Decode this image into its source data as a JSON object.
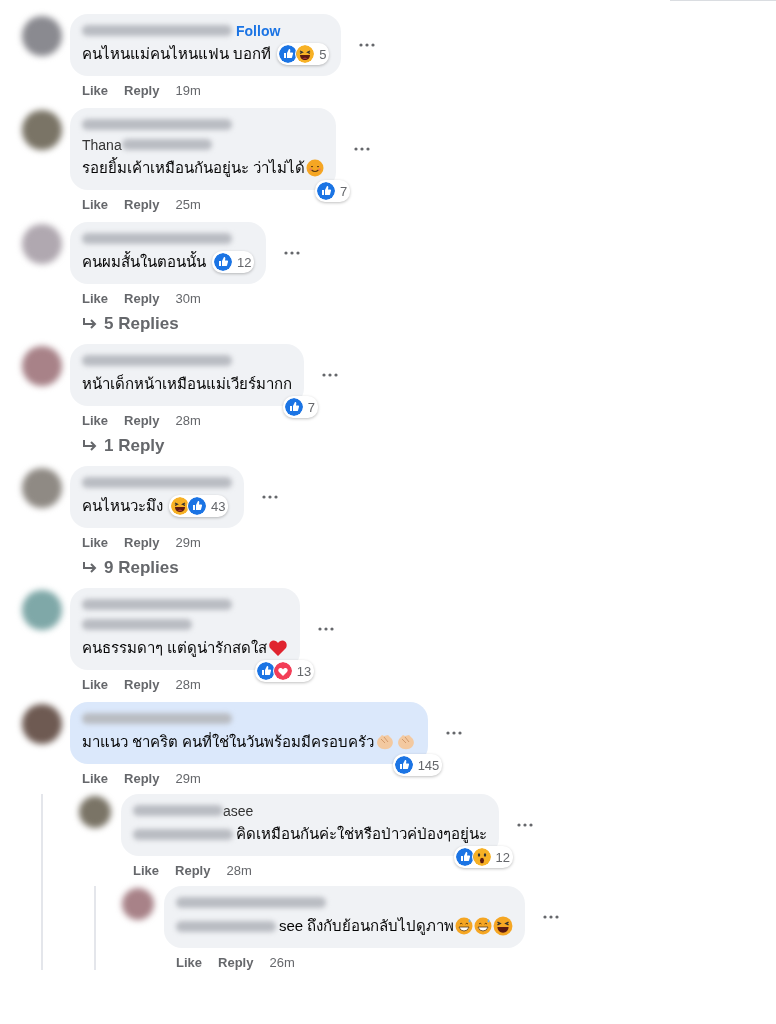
{
  "comments": [
    {
      "header": [
        {
          "kind": "blurred",
          "follow": "Follow"
        }
      ],
      "text": "คนไหนแม่คนไหนแฟน บอกที",
      "reactions": [
        {
          "kind": "like"
        },
        {
          "kind": "haha"
        }
      ],
      "reaction_count": "5",
      "inline": true,
      "like": "Like",
      "reply": "Reply",
      "time": "19m"
    },
    {
      "header": [
        {
          "kind": "blurred"
        },
        {
          "kind": "partial",
          "text": "Thana"
        }
      ],
      "text": "รอยยิ้มเค้าเหมือนกันอยู่นะ ว่าไม่ได้",
      "emojis": [
        {
          "kind": "smile"
        }
      ],
      "reactions": [
        {
          "kind": "like"
        }
      ],
      "reaction_count": "7",
      "inline": false,
      "like": "Like",
      "reply": "Reply",
      "time": "25m"
    },
    {
      "header": [
        {
          "kind": "blurred"
        }
      ],
      "text": "คนผมสั้นในตอนนั้น",
      "reactions": [
        {
          "kind": "like"
        }
      ],
      "reaction_count": "12",
      "inline": true,
      "like": "Like",
      "reply": "Reply",
      "time": "30m",
      "replies_link": "5 Replies"
    },
    {
      "header": [
        {
          "kind": "blurred"
        }
      ],
      "text": "หน้าเด็กหน้าเหมือนแม่เวียร์มากก",
      "reactions": [
        {
          "kind": "like"
        }
      ],
      "reaction_count": "7",
      "inline": false,
      "like": "Like",
      "reply": "Reply",
      "time": "28m",
      "replies_link": "1 Reply"
    },
    {
      "header": [
        {
          "kind": "blurred"
        }
      ],
      "text": "คนไหนวะมึง",
      "reactions": [
        {
          "kind": "haha"
        },
        {
          "kind": "like"
        }
      ],
      "reaction_count": "43",
      "inline": true,
      "like": "Like",
      "reply": "Reply",
      "time": "29m",
      "replies_link": "9 Replies"
    },
    {
      "header": [
        {
          "kind": "blurred"
        },
        {
          "kind": "blurred"
        }
      ],
      "text": "คนธรรมดาๆ แต่ดูน่ารักสดใส",
      "emojis": [
        {
          "kind": "heart"
        }
      ],
      "reactions": [
        {
          "kind": "like"
        },
        {
          "kind": "love"
        }
      ],
      "reaction_count": "13",
      "inline": false,
      "like": "Like",
      "reply": "Reply",
      "time": "28m"
    },
    {
      "header": [
        {
          "kind": "blurred"
        }
      ],
      "text": "มาแนว ชาคริต คนที่ใช่ในวันพร้อมมีครอบครัว",
      "emojis": [
        {
          "kind": "clap"
        },
        {
          "kind": "clap"
        }
      ],
      "reactions": [
        {
          "kind": "like"
        }
      ],
      "reaction_count": "145",
      "inline": false,
      "like": "Like",
      "reply": "Reply",
      "time": "29m",
      "highlighted": true,
      "replies": [
        {
          "header": [
            {
              "kind": "partial-end",
              "text": "asee"
            }
          ],
          "text_blurred_lead": true,
          "text": "คิดเหมือนกันค่ะใช่หรือป่าวค่ป่องๆอยู่นะ",
          "reactions": [
            {
              "kind": "like"
            },
            {
              "kind": "wow"
            }
          ],
          "reaction_count": "12",
          "inline": false,
          "like": "Like",
          "reply": "Reply",
          "time": "28m",
          "replies": [
            {
              "header": [
                {
                  "kind": "blurred"
                }
              ],
              "text_blurred_lead": true,
              "text": "see ถึงกับย้อนกลับไปดูภาพ",
              "emojis": [
                {
                  "kind": "sweat"
                },
                {
                  "kind": "sweat"
                },
                {
                  "kind": "laugh"
                }
              ],
              "like": "Like",
              "reply": "Reply",
              "time": "26m"
            }
          ]
        }
      ]
    }
  ]
}
